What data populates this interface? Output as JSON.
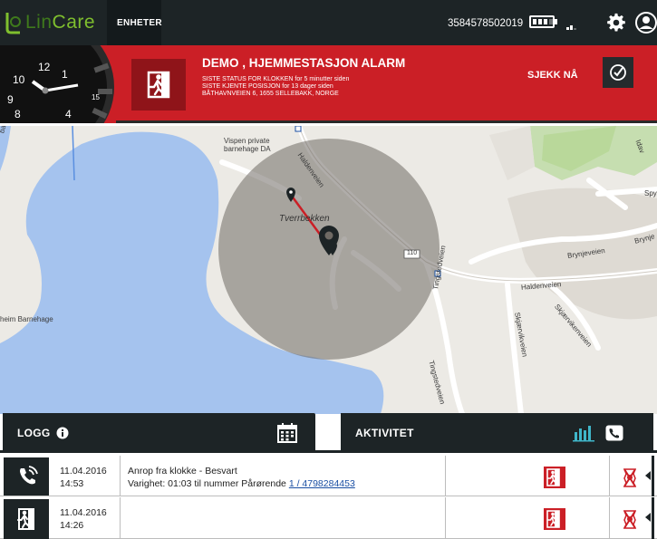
{
  "app": {
    "logo_text_a": "Lin",
    "logo_text_b": "Care"
  },
  "nav": {
    "units_label": "ENHETER",
    "phone_number": "3584578502019",
    "battery_level": 0.8
  },
  "alarm": {
    "title": "DEMO , HJEMMESTASJON ALARM",
    "line1": "SISTE STATUS FOR KLOKKEN for 5 minutter siden",
    "line2": "SISTE KJENTE POSISJON for 13 dager siden",
    "line3": "BÅTHAVNVEIEN 6, 1655 SELLEBAKK, NORGE",
    "check_label": "SJEKK NÅ",
    "watch_numbers": [
      "12",
      "1",
      "9",
      "10",
      "8",
      "4",
      "15"
    ]
  },
  "map": {
    "labels": {
      "vispen": "Vispen private",
      "barnehage": "barnehage DA",
      "haldenveien_a": "Haldenveien",
      "tverrbekken": "Tverrbekken",
      "road_110": "110",
      "brynjeveien_a": "Brynjeveien",
      "brynjeveien_b": "Brynje",
      "haldenveien_b": "Haldenveien",
      "tingstedveien_a": "Tingstedveien",
      "tingstedveien_b": "Tingstedveien",
      "skjaervikveien_a": "Skjærvikveien",
      "skjaervikveien_b": "Skjærvikenveien",
      "barnehage_left": "heim Barnehage",
      "bakken": "bakken",
      "idav": "Idav",
      "spy": "Spy"
    }
  },
  "panels": {
    "logg_title": "LOGG",
    "activity_title": "AKTIVITET"
  },
  "log": [
    {
      "date": "11.04.2016",
      "time": "14:53",
      "text": "Anrop fra klokke - Besvart",
      "detail": "Varighet: 01:03 til nummer Pårørende ",
      "link": "1 / 4798284453",
      "icon": "phone-icon"
    },
    {
      "date": "11.04.2016",
      "time": "14:26",
      "text": "",
      "detail": "",
      "link": "",
      "icon": "exit-icon"
    }
  ],
  "colors": {
    "brand_dark": "#1d2426",
    "alarm_red": "#cb1f26",
    "accent_green": "#7fbf2e",
    "water": "#a5c3ee",
    "link_blue": "#1a4fa3"
  }
}
